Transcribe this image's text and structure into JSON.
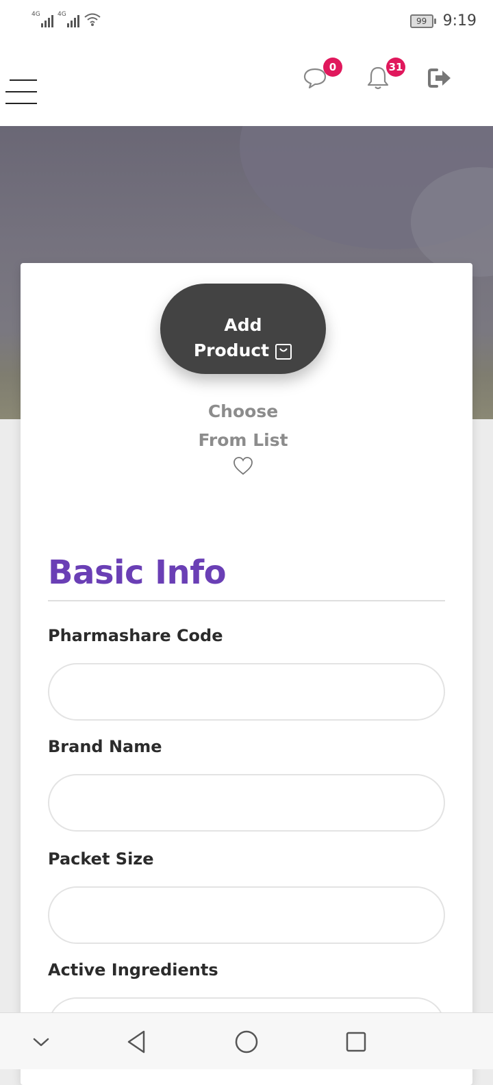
{
  "status_bar": {
    "network1": "4G",
    "network2": "4G",
    "battery": "99",
    "time": "9:19"
  },
  "header": {
    "chat_count": "0",
    "notification_count": "31"
  },
  "actions": {
    "add_product_line1": "Add",
    "add_product_line2": "Product",
    "choose_line1": "Choose",
    "choose_line2": "From List"
  },
  "form": {
    "section_title": "Basic Info",
    "fields": [
      {
        "label": "Pharmashare Code",
        "value": ""
      },
      {
        "label": "Brand Name",
        "value": ""
      },
      {
        "label": "Packet Size",
        "value": ""
      },
      {
        "label": "Active Ingredients",
        "value": ""
      }
    ]
  },
  "colors": {
    "accent_purple": "#6a3fb5",
    "badge_pink": "#e0185c",
    "button_dark": "#434343"
  },
  "icons": {
    "menu": "hamburger-icon",
    "chat": "chat-bubble-icon",
    "notifications": "bell-icon",
    "logout": "logout-icon",
    "cart": "shopping-bag-icon",
    "favorite": "heart-icon"
  }
}
